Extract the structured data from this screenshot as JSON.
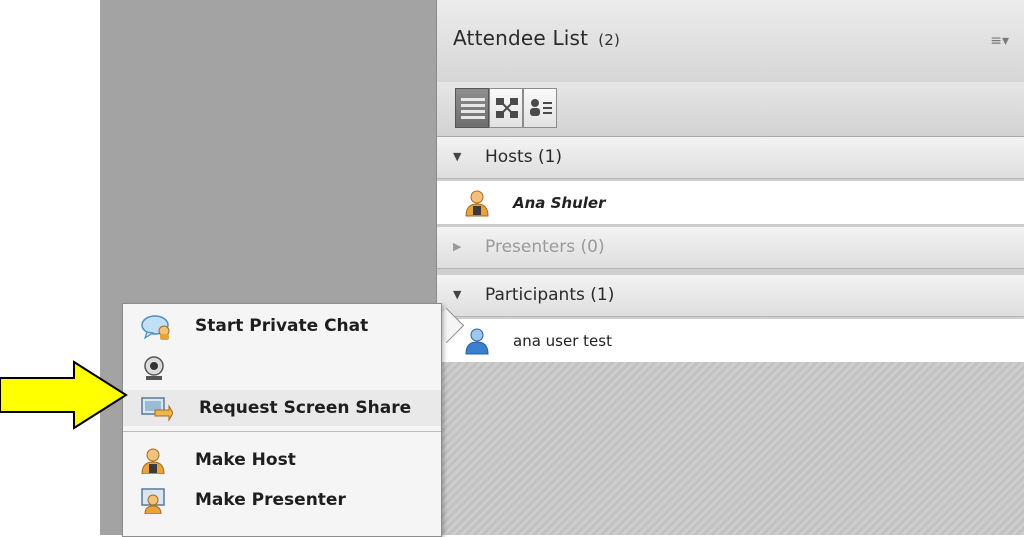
{
  "pod": {
    "title": "Attendee List",
    "count": "(2)",
    "menu_glyph": "≡▾",
    "view_buttons": [
      "list-view-icon",
      "grid-view-icon",
      "person-list-icon"
    ]
  },
  "groups": {
    "hosts": {
      "label": "Hosts (1)",
      "expanded": true,
      "members": [
        {
          "name": "Ana Shuler",
          "icon": "host-avatar-icon"
        }
      ]
    },
    "presenters": {
      "label": "Presenters (0)",
      "expanded": false
    },
    "participants": {
      "label": "Participants (1)",
      "expanded": true,
      "members": [
        {
          "name": "ana user test",
          "icon": "participant-avatar-icon"
        }
      ]
    }
  },
  "context_menu": {
    "items": [
      {
        "label": "Start Private Chat",
        "icon": "chat-bubble-icon"
      },
      {
        "label": "",
        "icon": "webcam-icon"
      },
      {
        "label": "Request Screen Share",
        "icon": "screen-share-icon"
      },
      {
        "label": "Make Host",
        "icon": "host-icon"
      },
      {
        "label": "Make Presenter",
        "icon": "presenter-icon"
      }
    ]
  },
  "annotation": {
    "arrow_color": "#ffff00",
    "icon": "yellow-arrow-icon"
  },
  "colors": {
    "stage": "#a3a3a3",
    "host_avatar": "#e8a33a",
    "participant_avatar": "#3b7fcf"
  }
}
